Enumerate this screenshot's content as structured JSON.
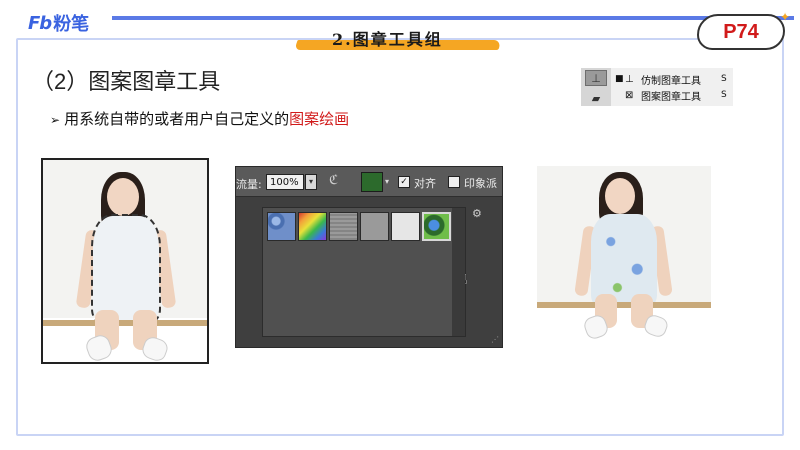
{
  "header": {
    "logo_mark": "Fb",
    "logo_text": "粉笔",
    "title": "2.图章工具组",
    "page_badge": "P74"
  },
  "section": {
    "heading": "（2）图案图章工具",
    "bullet_arrow": "➢",
    "bullet_text": "用系统自带的或者用户自己定义的",
    "bullet_highlight": "图案绘画"
  },
  "tool_popup": {
    "items": [
      {
        "icon": "clone-stamp-icon",
        "label": "仿制图章工具",
        "shortcut": "S",
        "active": true
      },
      {
        "icon": "pattern-stamp-icon",
        "label": "图案图章工具",
        "shortcut": "S",
        "active": false
      }
    ]
  },
  "ps_options": {
    "label_partial": "流量:",
    "flow_value": "100%",
    "aligned_label": "对齐",
    "impressionist_label": "印象派",
    "aligned_checked": true,
    "impressionist_checked": false
  },
  "patterns": [
    {
      "name": "blue-bubbles-pattern",
      "color": "#4a6fb0"
    },
    {
      "name": "rainbow-pattern",
      "color": "#c94a3a"
    },
    {
      "name": "gray-grid-pattern",
      "color": "#8b8b8b"
    },
    {
      "name": "gray-pattern",
      "color": "#9a9a9a"
    },
    {
      "name": "white-pattern",
      "color": "#e6e6e6"
    },
    {
      "name": "blue-flower-pattern",
      "color": "#2c6a2c",
      "selected": true
    }
  ],
  "colors": {
    "accent_blue": "#3a63e0",
    "highlight_red": "#d11a1a",
    "banner_orange": "#f5a623"
  }
}
